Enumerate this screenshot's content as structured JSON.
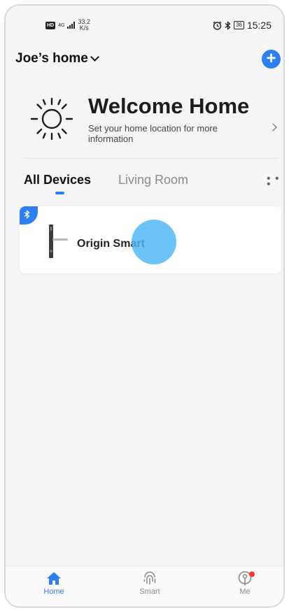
{
  "status_bar": {
    "hd": "HD",
    "network": "4G",
    "speed_value": "33.2",
    "speed_unit": "K/s",
    "battery": "36",
    "time": "15:25"
  },
  "header": {
    "home_name": "Joe’s home",
    "add_icon": "plus-icon"
  },
  "welcome": {
    "title": "Welcome Home",
    "subtitle": "Set your home location for more information",
    "icon": "sun-icon"
  },
  "tabs": [
    {
      "label": "All Devices",
      "active": true
    },
    {
      "label": "Living Room",
      "active": false
    }
  ],
  "devices": [
    {
      "name": "Origin Smart",
      "connection": "bluetooth"
    }
  ],
  "bottom_nav": [
    {
      "label": "Home",
      "icon": "home-icon",
      "active": true
    },
    {
      "label": "Smart",
      "icon": "smart-icon",
      "active": false
    },
    {
      "label": "Me",
      "icon": "me-icon",
      "active": false,
      "has_notification": true
    }
  ],
  "colors": {
    "accent": "#2d7ff0",
    "touch_indicator": "#4ab6f6",
    "notification": "#f23a3a"
  }
}
